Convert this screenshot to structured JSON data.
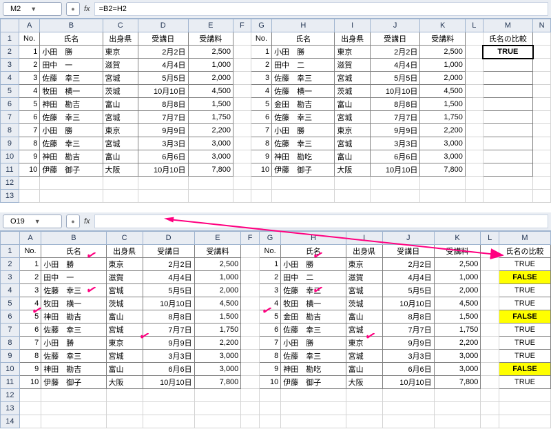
{
  "top": {
    "namebox": "M2",
    "formula": "=B2=H2",
    "cols": [
      "",
      "A",
      "B",
      "C",
      "D",
      "E",
      "F",
      "G",
      "H",
      "I",
      "J",
      "K",
      "L",
      "M",
      "N"
    ],
    "widths": [
      22,
      26,
      78,
      44,
      62,
      56,
      22,
      26,
      78,
      44,
      62,
      56,
      22,
      62,
      22
    ],
    "headers_left": [
      "No.",
      "氏名",
      "出身県",
      "受講日",
      "受講料"
    ],
    "headers_right": [
      "No.",
      "氏名",
      "出身県",
      "受講日",
      "受講料"
    ],
    "result_header": "氏名の比較",
    "rows": [
      {
        "n": 1,
        "name": "小田　勝",
        "pref": "東京",
        "date": "2月2日",
        "fee": "2,500",
        "n2": 1,
        "name2": "小田　勝",
        "pref2": "東京",
        "date2": "2月2日",
        "fee2": "2,500"
      },
      {
        "n": 2,
        "name": "田中　一",
        "pref": "滋賀",
        "date": "4月4日",
        "fee": "1,000",
        "n2": 2,
        "name2": "田中　二",
        "pref2": "滋賀",
        "date2": "4月4日",
        "fee2": "1,000"
      },
      {
        "n": 3,
        "name": "佐藤　幸三",
        "pref": "宮城",
        "date": "5月5日",
        "fee": "2,000",
        "n2": 3,
        "name2": "佐藤　幸三",
        "pref2": "宮城",
        "date2": "5月5日",
        "fee2": "2,000"
      },
      {
        "n": 4,
        "name": "牧田　横一",
        "pref": "茨城",
        "date": "10月10日",
        "fee": "4,500",
        "n2": 4,
        "name2": "佐藤　横一",
        "pref2": "茨城",
        "date2": "10月10日",
        "fee2": "4,500"
      },
      {
        "n": 5,
        "name": "神田　勘吉",
        "pref": "富山",
        "date": "8月8日",
        "fee": "1,500",
        "n2": 5,
        "name2": "金田　勘吉",
        "pref2": "富山",
        "date2": "8月8日",
        "fee2": "1,500"
      },
      {
        "n": 6,
        "name": "佐藤　幸三",
        "pref": "宮城",
        "date": "7月7日",
        "fee": "1,750",
        "n2": 6,
        "name2": "佐藤　幸三",
        "pref2": "宮城",
        "date2": "7月7日",
        "fee2": "1,750"
      },
      {
        "n": 7,
        "name": "小田　勝",
        "pref": "東京",
        "date": "9月9日",
        "fee": "2,200",
        "n2": 7,
        "name2": "小田　勝",
        "pref2": "東京",
        "date2": "9月9日",
        "fee2": "2,200"
      },
      {
        "n": 8,
        "name": "佐藤　幸三",
        "pref": "宮城",
        "date": "3月3日",
        "fee": "3,000",
        "n2": 8,
        "name2": "佐藤　幸三",
        "pref2": "宮城",
        "date2": "3月3日",
        "fee2": "3,000"
      },
      {
        "n": 9,
        "name": "神田　勘吉",
        "pref": "富山",
        "date": "6月6日",
        "fee": "3,000",
        "n2": 9,
        "name2": "神田　勘吃",
        "pref2": "富山",
        "date2": "6月6日",
        "fee2": "3,000"
      },
      {
        "n": 10,
        "name": "伊藤　御子",
        "pref": "大阪",
        "date": "10月10日",
        "fee": "7,800",
        "n2": 10,
        "name2": "伊藤　御子",
        "pref2": "大阪",
        "date2": "10月10日",
        "fee2": "7,800"
      }
    ],
    "m2": "TRUE",
    "empty_rows": [
      12,
      13
    ]
  },
  "bot": {
    "namebox": "O19",
    "formula": "",
    "cols": [
      "",
      "A",
      "B",
      "C",
      "D",
      "E",
      "F",
      "G",
      "H",
      "I",
      "J",
      "K",
      "L",
      "M"
    ],
    "widths": [
      22,
      26,
      78,
      44,
      62,
      56,
      22,
      26,
      78,
      44,
      62,
      56,
      22,
      62
    ],
    "headers_left": [
      "No.",
      "氏名",
      "出身県",
      "受講日",
      "受講料"
    ],
    "headers_right": [
      "No.",
      "氏名",
      "出身県",
      "受講日",
      "受講料"
    ],
    "result_header": "氏名の比較",
    "rows": [
      {
        "n": 1,
        "name": "小田　勝",
        "pref": "東京",
        "date": "2月2日",
        "fee": "2,500",
        "n2": 1,
        "name2": "小田　勝",
        "pref2": "東京",
        "date2": "2月2日",
        "fee2": "2,500",
        "res": "TRUE"
      },
      {
        "n": 2,
        "name": "田中　一",
        "pref": "滋賀",
        "date": "4月4日",
        "fee": "1,000",
        "n2": 2,
        "name2": "田中　二",
        "pref2": "滋賀",
        "date2": "4月4日",
        "fee2": "1,000",
        "res": "FALSE"
      },
      {
        "n": 3,
        "name": "佐藤　幸三",
        "pref": "宮城",
        "date": "5月5日",
        "fee": "2,000",
        "n2": 3,
        "name2": "佐藤　幸三",
        "pref2": "宮城",
        "date2": "5月5日",
        "fee2": "2,000",
        "res": "TRUE"
      },
      {
        "n": 4,
        "name": "牧田　横一",
        "pref": "茨城",
        "date": "10月10日",
        "fee": "4,500",
        "n2": 4,
        "name2": "牧田　横一",
        "pref2": "茨城",
        "date2": "10月10日",
        "fee2": "4,500",
        "res": "TRUE"
      },
      {
        "n": 5,
        "name": "神田　勘吉",
        "pref": "富山",
        "date": "8月8日",
        "fee": "1,500",
        "n2": 5,
        "name2": "金田　勘吉",
        "pref2": "富山",
        "date2": "8月8日",
        "fee2": "1,500",
        "res": "FALSE"
      },
      {
        "n": 6,
        "name": "佐藤　幸三",
        "pref": "宮城",
        "date": "7月7日",
        "fee": "1,750",
        "n2": 6,
        "name2": "佐藤　幸三",
        "pref2": "宮城",
        "date2": "7月7日",
        "fee2": "1,750",
        "res": "TRUE"
      },
      {
        "n": 7,
        "name": "小田　勝",
        "pref": "東京",
        "date": "9月9日",
        "fee": "2,200",
        "n2": 7,
        "name2": "小田　勝",
        "pref2": "東京",
        "date2": "9月9日",
        "fee2": "2,200",
        "res": "TRUE"
      },
      {
        "n": 8,
        "name": "佐藤　幸三",
        "pref": "宮城",
        "date": "3月3日",
        "fee": "3,000",
        "n2": 8,
        "name2": "佐藤　幸三",
        "pref2": "宮城",
        "date2": "3月3日",
        "fee2": "3,000",
        "res": "TRUE"
      },
      {
        "n": 9,
        "name": "神田　勘吉",
        "pref": "富山",
        "date": "6月6日",
        "fee": "3,000",
        "n2": 9,
        "name2": "神田　勘吃",
        "pref2": "富山",
        "date2": "6月6日",
        "fee2": "3,000",
        "res": "FALSE"
      },
      {
        "n": 10,
        "name": "伊藤　御子",
        "pref": "大阪",
        "date": "10月10日",
        "fee": "7,800",
        "n2": 10,
        "name2": "伊藤　御子",
        "pref2": "大阪",
        "date2": "10月10日",
        "fee2": "7,800",
        "res": "TRUE"
      }
    ],
    "empty_rows": [
      12,
      13,
      14
    ]
  }
}
